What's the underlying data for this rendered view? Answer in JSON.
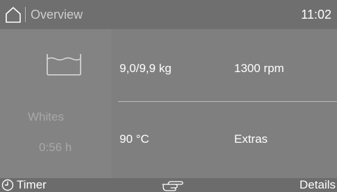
{
  "header": {
    "title": "Overview",
    "time": "11:02",
    "home_icon": "home-icon"
  },
  "program": {
    "name": "Whites",
    "duration": "0:56 h",
    "icon": "wash-tub-icon"
  },
  "params": {
    "load": "9,0/9,9 kg",
    "spin": "1300 rpm",
    "temperature": "90 °C",
    "extras": "Extras"
  },
  "footer": {
    "timer_label": "Timer",
    "details_label": "Details",
    "timer_icon": "clock-icon",
    "center_icon": "hand-pointer-icon"
  },
  "colors": {
    "background": "#7f7f7f",
    "header_bar": "#6f6f6f",
    "footer_bar": "#6c6c6c",
    "text_primary": "#ffffff",
    "text_muted": "#a8a8a8"
  }
}
